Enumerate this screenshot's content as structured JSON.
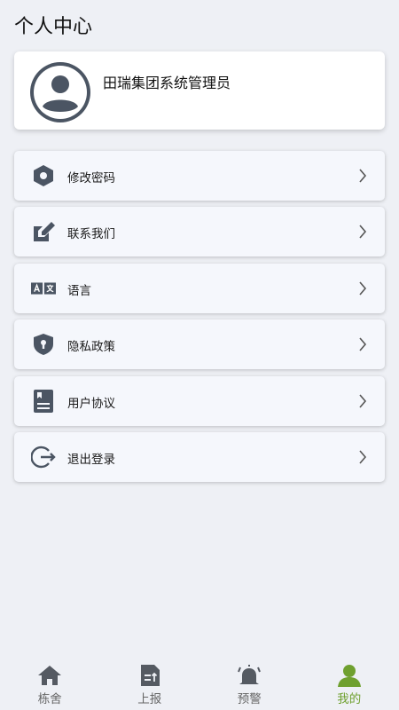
{
  "header": {
    "title": "个人中心"
  },
  "profile": {
    "name": "田瑞集团系统管理员",
    "avatar_icon": "user-avatar-icon"
  },
  "menu": {
    "items": [
      {
        "id": "change-password",
        "label": "修改密码",
        "icon": "hexagon-nut-icon"
      },
      {
        "id": "contact-us",
        "label": "联系我们",
        "icon": "edit-note-icon"
      },
      {
        "id": "language",
        "label": "语言",
        "icon": "translate-icon"
      },
      {
        "id": "privacy-policy",
        "label": "隐私政策",
        "icon": "shield-lock-icon"
      },
      {
        "id": "user-agreement",
        "label": "用户协议",
        "icon": "document-icon"
      },
      {
        "id": "logout",
        "label": "退出登录",
        "icon": "logout-icon"
      }
    ]
  },
  "tabbar": {
    "tabs": [
      {
        "label": "栋舍",
        "icon": "home-icon",
        "active": false
      },
      {
        "label": "上报",
        "icon": "report-icon",
        "active": false
      },
      {
        "label": "预警",
        "icon": "alarm-bell-icon",
        "active": false
      },
      {
        "label": "我的",
        "icon": "user-icon",
        "active": true
      }
    ]
  },
  "colors": {
    "background": "#eef0f5",
    "icon": "#4b5563",
    "accent": "#6fa02f",
    "card": "#ffffff",
    "menu_card": "#f5f7fc"
  }
}
